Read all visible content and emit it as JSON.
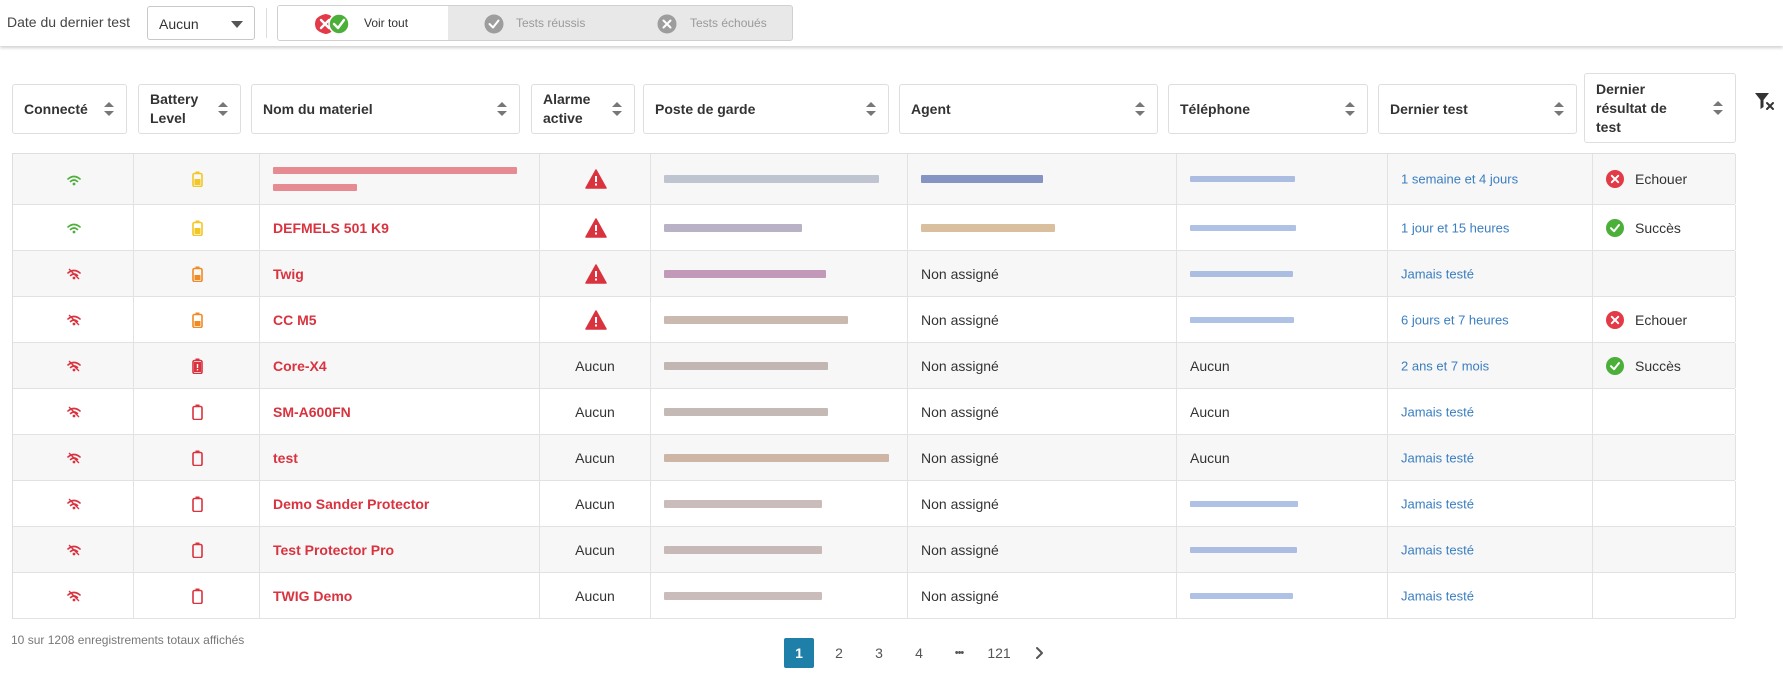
{
  "toolbar": {
    "filter_label": "Date du dernier test",
    "select_value": "Aucun",
    "segments": [
      {
        "label": "Voir tout",
        "active": true
      },
      {
        "label": "Tests réussis",
        "active": false
      },
      {
        "label": "Tests échoués",
        "active": false
      }
    ]
  },
  "colors": {
    "accent_red": "#d9333f",
    "success_green": "#4caf3a",
    "link_blue": "#3a7ec0",
    "battery_yellow": "#f2c624",
    "battery_orange": "#f08a24",
    "page_active": "#1e7fa8"
  },
  "table": {
    "headers": {
      "connecte": "Connecté",
      "battery_1": "Battery",
      "battery_2": "Level",
      "nom": "Nom du materiel",
      "alarme_1": "Alarme",
      "alarme_2": "active",
      "poste": "Poste de garde",
      "agent": "Agent",
      "telephone": "Téléphone",
      "dernier_test": "Dernier test",
      "resultat_1": "Dernier",
      "resultat_2": "résultat de",
      "resultat_3": "test"
    },
    "rows": [
      {
        "connected": true,
        "battery": "yellow",
        "name": "",
        "alarm": "warning",
        "agent": "",
        "phone": "",
        "last_test": "1 semaine et 4 jours",
        "result": "Echouer",
        "result_status": "fail"
      },
      {
        "connected": true,
        "battery": "yellow",
        "name": "DEFMELS 501 K9",
        "alarm": "warning",
        "agent": "",
        "phone": "",
        "last_test": "1 jour et 15 heures",
        "result": "Succès",
        "result_status": "success"
      },
      {
        "connected": false,
        "battery": "orange",
        "name": "Twig",
        "alarm": "warning",
        "agent": "Non assigné",
        "phone": "",
        "last_test": "Jamais testé",
        "result": "",
        "result_status": "none"
      },
      {
        "connected": false,
        "battery": "orange",
        "name": "CC M5",
        "alarm": "warning",
        "agent": "Non assigné",
        "phone": "",
        "last_test": "6 jours et 7 heures",
        "result": "Echouer",
        "result_status": "fail"
      },
      {
        "connected": false,
        "battery": "critical",
        "name": "Core-X4",
        "alarm": "Aucun",
        "agent": "Non assigné",
        "phone": "Aucun",
        "last_test": "2 ans et 7 mois",
        "result": "Succès",
        "result_status": "success"
      },
      {
        "connected": false,
        "battery": "empty",
        "name": "SM-A600FN",
        "alarm": "Aucun",
        "agent": "Non assigné",
        "phone": "Aucun",
        "last_test": "Jamais testé",
        "result": "",
        "result_status": "none"
      },
      {
        "connected": false,
        "battery": "empty",
        "name": "test",
        "alarm": "Aucun",
        "agent": "Non assigné",
        "phone": "Aucun",
        "last_test": "Jamais testé",
        "result": "",
        "result_status": "none"
      },
      {
        "connected": false,
        "battery": "empty",
        "name": "Demo Sander Protector",
        "alarm": "Aucun",
        "agent": "Non assigné",
        "phone": "",
        "last_test": "Jamais testé",
        "result": "",
        "result_status": "none"
      },
      {
        "connected": false,
        "battery": "empty",
        "name": "Test Protector Pro",
        "alarm": "Aucun",
        "agent": "Non assigné",
        "phone": "",
        "last_test": "Jamais testé",
        "result": "",
        "result_status": "none"
      },
      {
        "connected": false,
        "battery": "empty",
        "name": "TWIG Demo",
        "alarm": "Aucun",
        "agent": "Non assigné",
        "phone": "",
        "last_test": "Jamais testé",
        "result": "",
        "result_status": "none"
      }
    ]
  },
  "footer": {
    "shown": "10",
    "sur": "sur",
    "total": "1208",
    "suffix": "enregistrements totaux affichés"
  },
  "pagination": {
    "pages": [
      "1",
      "2",
      "3",
      "4",
      "•••",
      "121"
    ],
    "current": "1",
    "next_icon": "chevron-right-icon"
  }
}
